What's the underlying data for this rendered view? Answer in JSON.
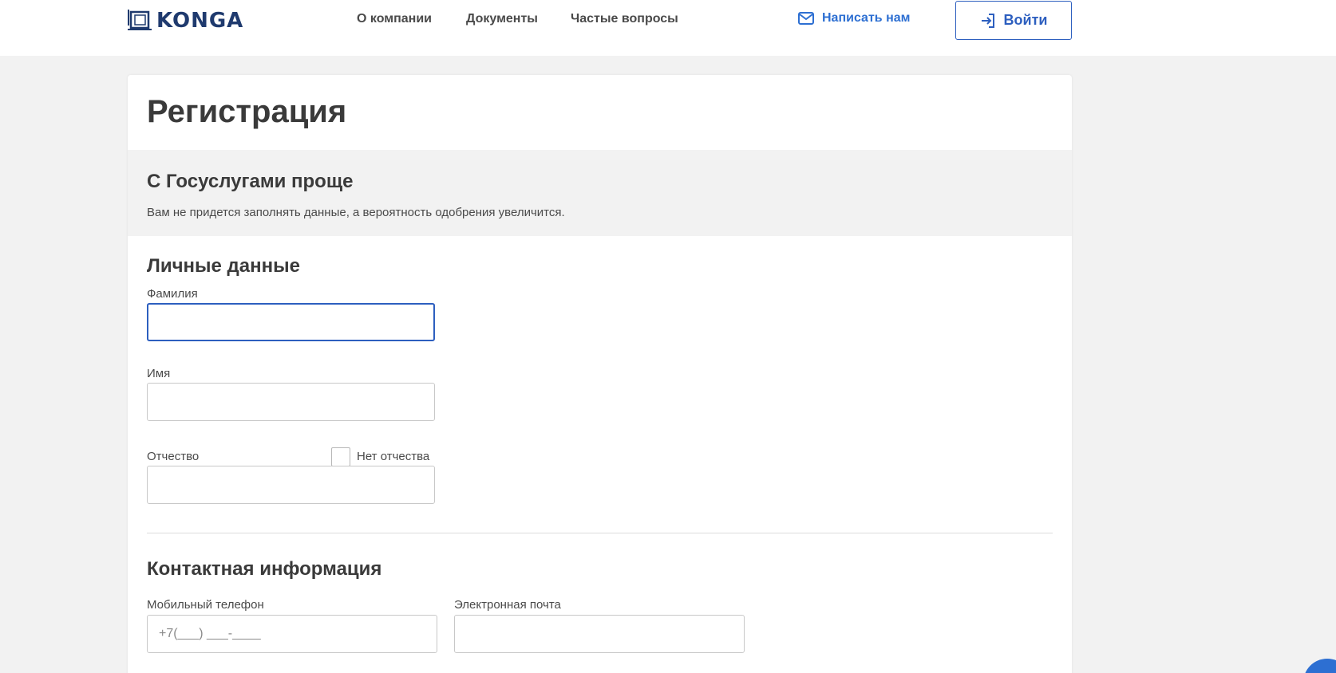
{
  "header": {
    "logo_text": "KONGA",
    "nav": [
      "О компании",
      "Документы",
      "Частые вопросы"
    ],
    "contact_label": "Написать нам",
    "login_label": "Войти"
  },
  "page": {
    "title": "Регистрация"
  },
  "gosuslugi": {
    "title": "С Госуслугами проще",
    "text": "Вам не придется заполнять данные, а вероятность одобрения увеличится."
  },
  "personal": {
    "title": "Личные данные",
    "surname_label": "Фамилия",
    "surname_value": "",
    "name_label": "Имя",
    "name_value": "",
    "patronymic_label": "Отчество",
    "patronymic_value": "",
    "no_patronymic_label": "Нет отчества"
  },
  "contacts": {
    "title": "Контактная информация",
    "phone_label": "Мобильный телефон",
    "phone_placeholder": "+7(___) ___-____",
    "email_label": "Электронная почта",
    "email_value": ""
  },
  "colors": {
    "accent": "#2d5fbf",
    "link": "#2d6fd2",
    "logo": "#1f3a6e",
    "background": "#f2f2f2"
  }
}
